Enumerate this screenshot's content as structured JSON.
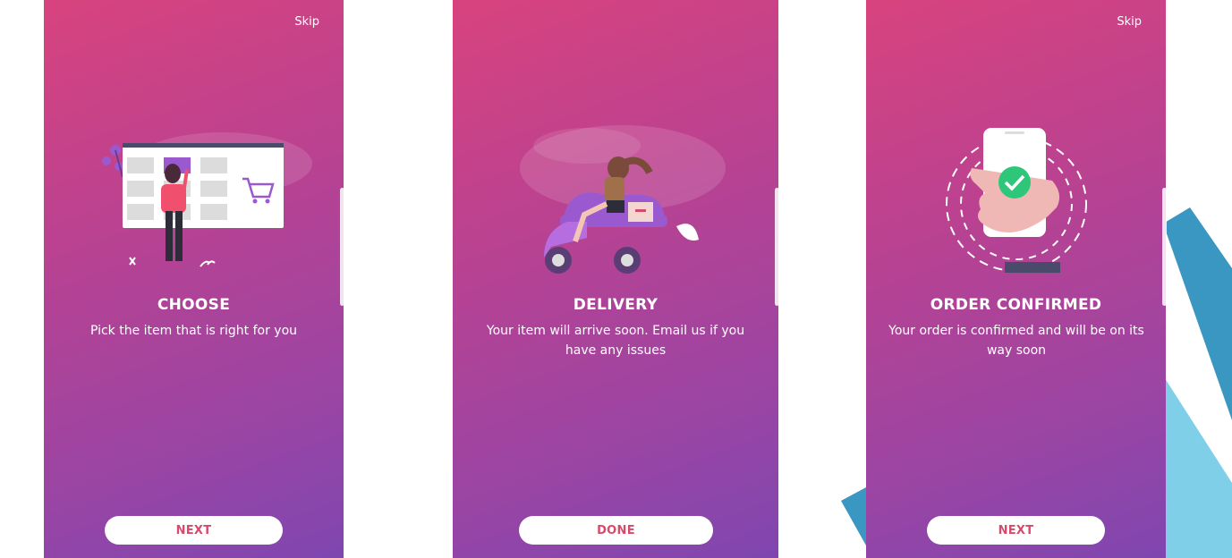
{
  "colors": {
    "gradient_start": "#d8437e",
    "gradient_end": "#7f46b0",
    "button_text": "#d64a6b",
    "accent_purple": "#9b59d0",
    "deco_blue_dark": "#3a97c2",
    "deco_blue_light": "#7fcfe8"
  },
  "screens": [
    {
      "skip": "Skip",
      "title": "CHOOSE",
      "description": "Pick the item that is right for you",
      "button": "NEXT",
      "illustration": "woman-choosing-item-icon"
    },
    {
      "title": "DELIVERY",
      "description": "Your item will arrive soon. Email us if you have any issues",
      "button": "DONE",
      "illustration": "scooter-delivery-icon"
    },
    {
      "skip": "Skip",
      "title": "ORDER CONFIRMED",
      "description": "Your order is confirmed and will be on its way soon",
      "button": "NEXT",
      "illustration": "phone-checkmark-icon"
    }
  ]
}
